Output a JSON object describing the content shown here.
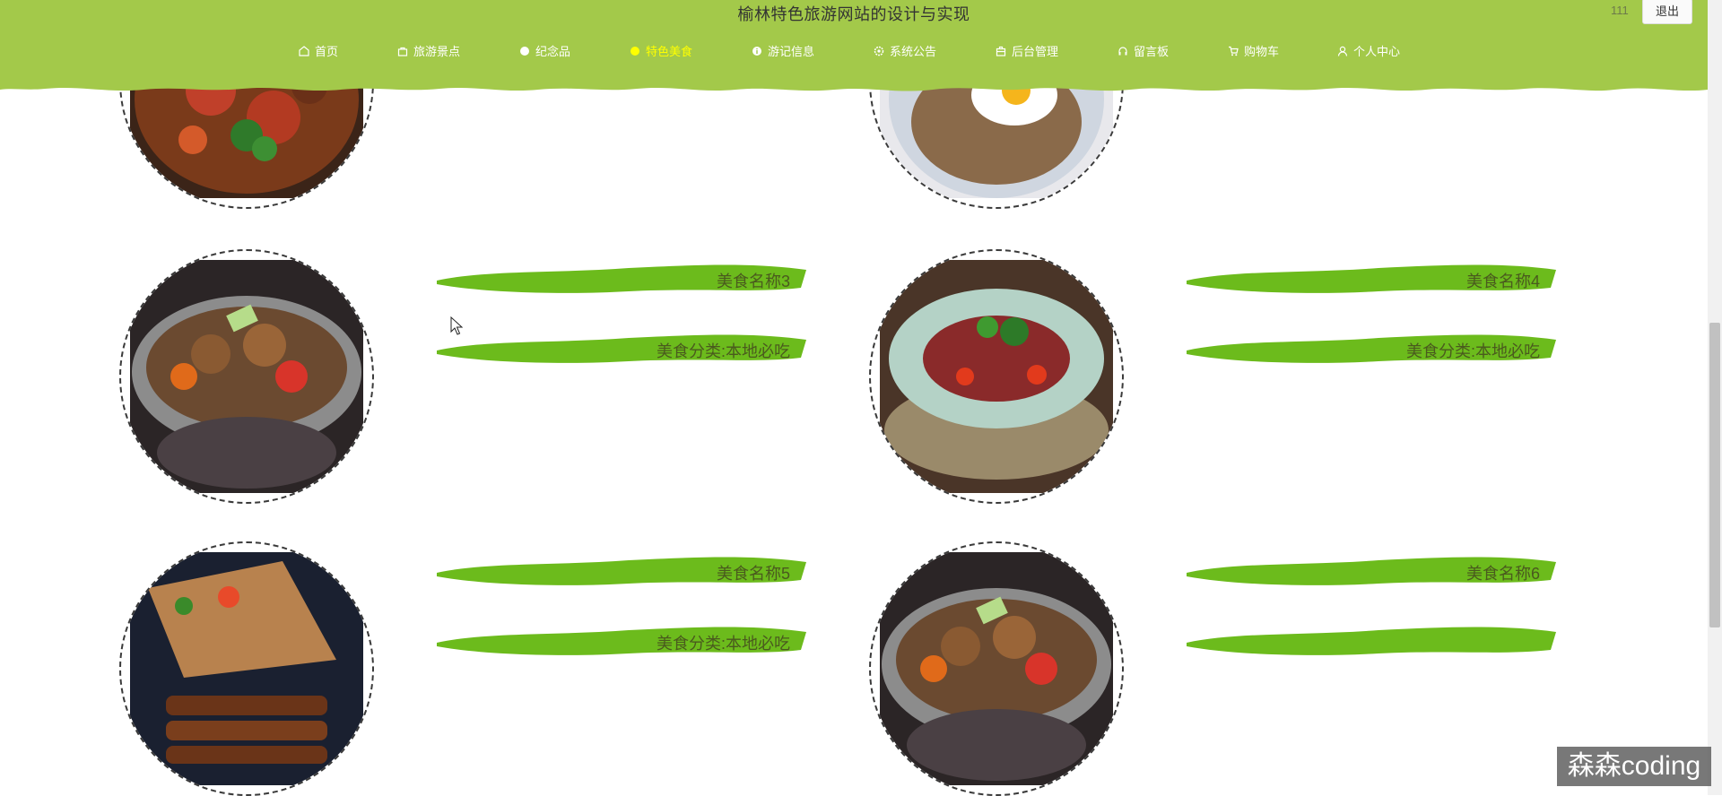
{
  "header": {
    "site_title": "榆林特色旅游网站的设计与实现",
    "user_name": "111",
    "logout_label": "退出",
    "background_color": "#a3c94a",
    "active_color": "#ffff00"
  },
  "nav": {
    "items": [
      {
        "label": "首页",
        "icon": "home-icon"
      },
      {
        "label": "旅游景点",
        "icon": "bag-icon"
      },
      {
        "label": "纪念品",
        "icon": "circle-icon"
      },
      {
        "label": "特色美食",
        "icon": "circle-icon",
        "active": true
      },
      {
        "label": "游记信息",
        "icon": "info-icon"
      },
      {
        "label": "系统公告",
        "icon": "gear-icon"
      },
      {
        "label": "后台管理",
        "icon": "briefcase-icon"
      },
      {
        "label": "留言板",
        "icon": "headset-icon"
      },
      {
        "label": "购物车",
        "icon": "cart-icon"
      },
      {
        "label": "个人中心",
        "icon": "user-icon"
      }
    ]
  },
  "foods": [
    {
      "image": "stir-fry-dish-image",
      "name": "",
      "category": ""
    },
    {
      "image": "fried-rice-egg-image",
      "name": "",
      "category": ""
    },
    {
      "image": "lamb-pot-image",
      "name": "美食名称3",
      "category": "美食分类:本地必吃"
    },
    {
      "image": "steak-salad-image",
      "name": "美食名称4",
      "category": "美食分类:本地必吃"
    },
    {
      "image": "grilled-eel-image",
      "name": "美食名称5",
      "category": "美食分类:本地必吃"
    },
    {
      "image": "lamb-pot-image",
      "name": "美食名称6",
      "category": ""
    }
  ],
  "brush_color": "#6cbb1c",
  "watermark": "森森coding"
}
